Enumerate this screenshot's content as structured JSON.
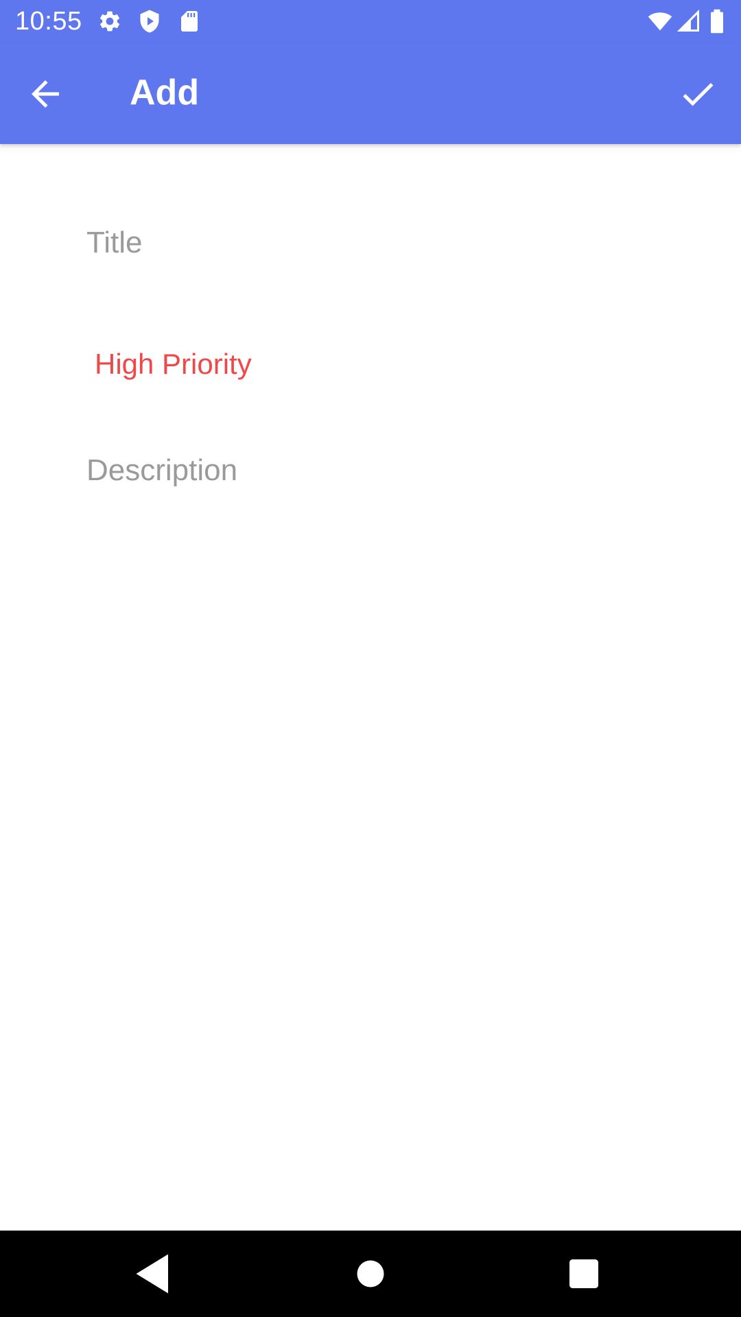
{
  "status_bar": {
    "time": "10:55",
    "background": "#5f77ee",
    "left_icons": [
      "gear-icon",
      "shield-play-icon",
      "sd-card-icon"
    ],
    "right_icons": [
      "wifi-icon",
      "cell-signal-icon",
      "battery-icon"
    ]
  },
  "app_bar": {
    "title": "Add",
    "back_icon": "arrow-back-icon",
    "action_icon": "checkmark-icon",
    "background": "#5f77ee"
  },
  "form": {
    "title_placeholder": "Title",
    "title_value": "",
    "priority_label": "High Priority",
    "priority_color": "#f04848",
    "description_placeholder": "Description",
    "description_value": ""
  },
  "nav_bar": {
    "buttons": [
      "back-triangle-icon",
      "home-circle-icon",
      "recents-square-icon"
    ]
  }
}
